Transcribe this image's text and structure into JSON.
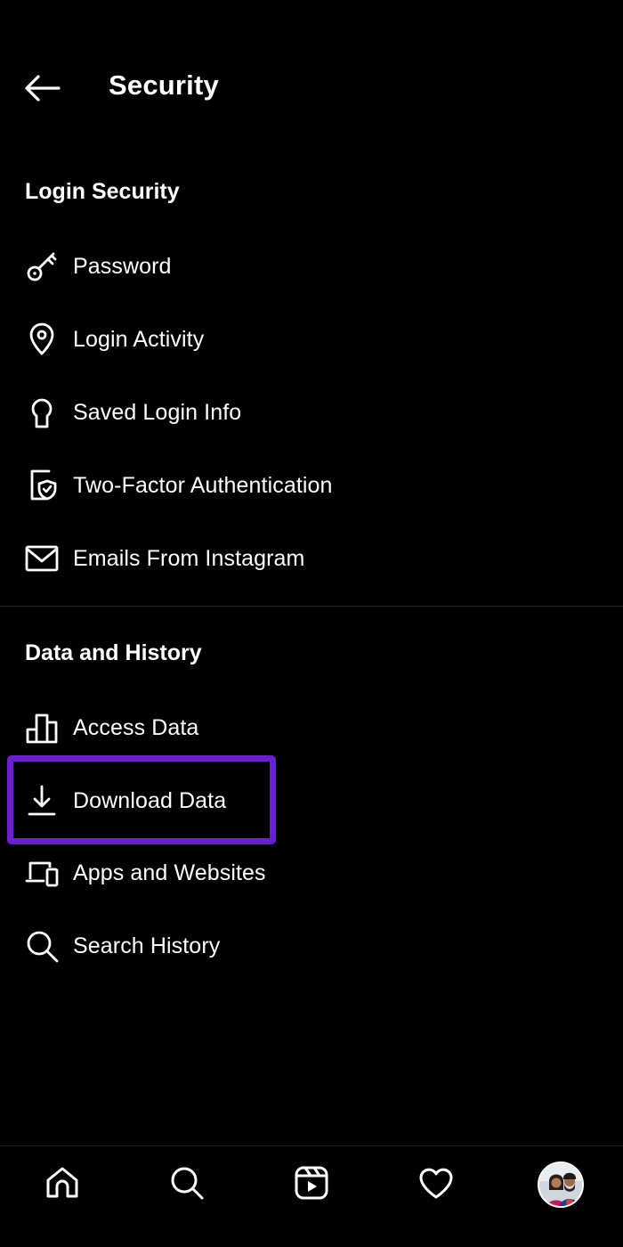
{
  "header": {
    "title": "Security",
    "back_icon": "arrow-left-icon"
  },
  "sections": [
    {
      "title": "Login Security"
    },
    {
      "title": "Data and History"
    }
  ],
  "login_security": [
    {
      "label": "Password",
      "icon": "key-icon"
    },
    {
      "label": "Login Activity",
      "icon": "location-pin-icon"
    },
    {
      "label": "Saved Login Info",
      "icon": "keyhole-icon"
    },
    {
      "label": "Two-Factor Authentication",
      "icon": "shield-check-icon"
    },
    {
      "label": "Emails From Instagram",
      "icon": "mail-icon"
    }
  ],
  "data_history": [
    {
      "label": "Access Data",
      "icon": "bar-chart-icon"
    },
    {
      "label": "Download Data",
      "icon": "download-icon",
      "highlighted": true
    },
    {
      "label": "Apps and Websites",
      "icon": "devices-icon"
    },
    {
      "label": "Search History",
      "icon": "search-icon"
    }
  ],
  "bottom_nav": [
    {
      "name": "home",
      "icon": "home-icon"
    },
    {
      "name": "search",
      "icon": "search-icon"
    },
    {
      "name": "reels",
      "icon": "reels-icon"
    },
    {
      "name": "activity",
      "icon": "heart-icon"
    },
    {
      "name": "profile",
      "icon": "avatar"
    }
  ],
  "colors": {
    "background": "#000000",
    "text": "#ffffff",
    "highlight": "#6a1fd0",
    "divider": "#262626"
  }
}
